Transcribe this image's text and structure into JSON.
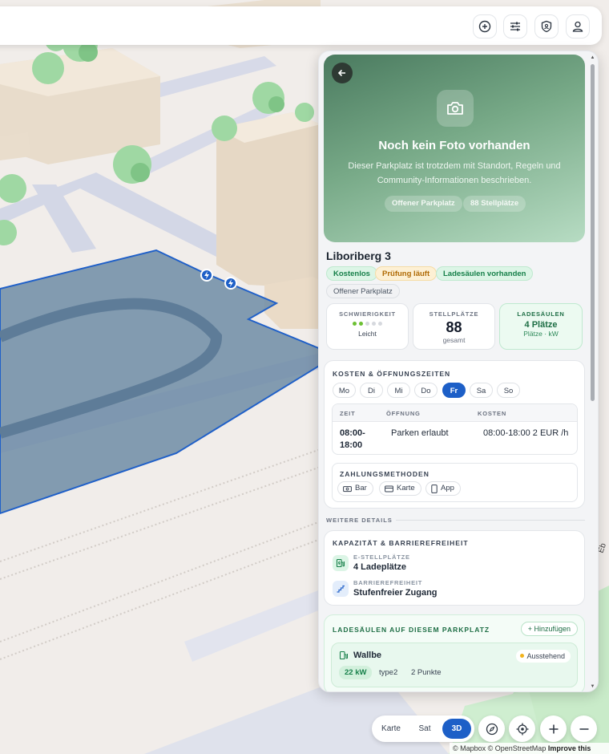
{
  "map": {
    "street_label": "Eb",
    "attribution": "© Mapbox © OpenStreetMap",
    "improve_link": "Improve this map",
    "charger_marker_icon": "lightning-icon"
  },
  "toolbar": {
    "icons": [
      "plus-circle-icon",
      "sliders-icon",
      "shield-icon",
      "user-icon"
    ]
  },
  "hero": {
    "title": "Noch kein Foto vorhanden",
    "description": "Dieser Parkplatz ist trotzdem mit Standort, Regeln und Community-Informationen beschrieben.",
    "chips": [
      "Offener Parkplatz",
      "88 Stellplätze"
    ]
  },
  "lot": {
    "name": "Liboriberg 3",
    "tags": [
      "Kostenlos",
      "Prüfung läuft",
      "Ladesäulen vorhanden",
      "Offener Parkplatz"
    ]
  },
  "stats": {
    "difficulty": {
      "label": "SCHWIERIGKEIT",
      "value": "Leicht",
      "level": 2,
      "max": 5
    },
    "spaces": {
      "label": "STELLPLÄTZE",
      "value": "88",
      "sub": "gesamt"
    },
    "chargers": {
      "label": "LADESÄULEN",
      "value": "4 Plätze",
      "sub": "Plätze · kW"
    }
  },
  "hours": {
    "title": "KOSTEN & ÖFFNUNGSZEITEN",
    "days": [
      "Mo",
      "Di",
      "Mi",
      "Do",
      "Fr",
      "Sa",
      "So"
    ],
    "active_day": "Fr",
    "columns": [
      "ZEIT",
      "ÖFFNUNG",
      "KOSTEN"
    ],
    "rows": [
      {
        "time_line1": "08:00-",
        "time_line2": "18:00",
        "opening": "Parken erlaubt",
        "cost": "08:00-18:00 2 EUR /h"
      }
    ],
    "payment_title": "ZAHLUNGSMETHODEN",
    "payments": [
      "Bar",
      "Karte",
      "App"
    ]
  },
  "more": {
    "label": "WEITERE DETAILS",
    "capacity_title": "KAPAZITÄT & BARRIEREFREIHEIT",
    "features": [
      {
        "label": "E-STELLPLÄTZE",
        "value": "4 Ladeplätze"
      },
      {
        "label": "BARRIEREFREIHEIT",
        "value": "Stufenfreier Zugang"
      }
    ]
  },
  "chargers_section": {
    "title": "LADESÄULEN AUF DIESEM PARKPLATZ",
    "add_label": "+ Hinzufügen",
    "items": [
      {
        "name": "Wallbe",
        "status": "Ausstehend",
        "power": "22 kW",
        "plug": "type2",
        "points": "2 Punkte"
      }
    ]
  },
  "controls": {
    "modes": [
      "Karte",
      "Sat",
      "3D"
    ],
    "active_mode": "3D"
  },
  "colors": {
    "accent": "#1d5fc7",
    "lot_polygon": "#6f8ca6",
    "green": "#17804a",
    "amber": "#b06b06"
  }
}
